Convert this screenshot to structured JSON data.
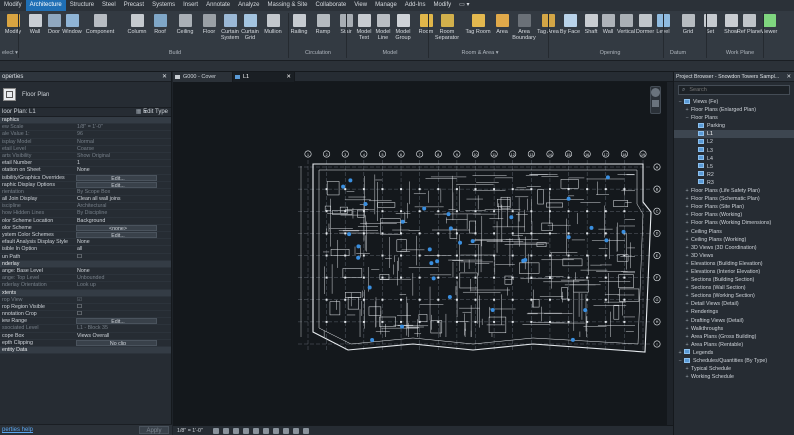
{
  "menu": [
    "Modify",
    "Architecture",
    "Structure",
    "Steel",
    "Precast",
    "Systems",
    "Insert",
    "Annotate",
    "Analyze",
    "Massing & Site",
    "Collaborate",
    "View",
    "Manage",
    "Add-Ins",
    "Modify",
    "▭ ▾"
  ],
  "menu_active_index": 1,
  "ribbon": {
    "buttons": [
      "Modify",
      "Wall",
      "Door",
      "Window",
      "Component",
      "Column",
      "Roof",
      "Ceiling",
      "Floor",
      "Curtain System",
      "Curtain Grid",
      "Mullion",
      "Railing",
      "Ramp",
      "Stair",
      "Model Text",
      "Model Line",
      "Model Group",
      "Room",
      "Room Separator",
      "Tag Room",
      "Area",
      "Area Boundary",
      "Tag Area",
      "By Face",
      "Shaft",
      "Wall",
      "Vertical",
      "Dormer",
      "Level",
      "Grid",
      "Set",
      "Show",
      "Ref Plane",
      "Viewer"
    ],
    "groups": [
      "elect ▾",
      "Build",
      "Circulation",
      "Model",
      "Room & Area ▾",
      "Opening",
      "Datum",
      "Work Plane"
    ]
  },
  "properties": {
    "title": "operties",
    "type_name": "Floor Plan",
    "instance_label": "loor Plan: L1",
    "edit_type_label": "Edit Type",
    "apply_label": "Apply",
    "help_link": "perties help",
    "rows": [
      {
        "k": "raphics",
        "v": "",
        "kind": "sec"
      },
      {
        "k": "ew Scale",
        "v": "1/8\" = 1'-0\"",
        "kind": "dim"
      },
      {
        "k": "ale Value 1:",
        "v": "96",
        "kind": "dim"
      },
      {
        "k": "isplay Model",
        "v": "Normal",
        "kind": "dim"
      },
      {
        "k": "etail Level",
        "v": "Coarse",
        "kind": "dim"
      },
      {
        "k": "arts Visibility",
        "v": "Show Original",
        "kind": "dim"
      },
      {
        "k": "etail Number",
        "v": "1",
        "kind": ""
      },
      {
        "k": "otation on Sheet",
        "v": "None",
        "kind": ""
      },
      {
        "k": "isibility/Graphics Overrides",
        "v": "Edit...",
        "kind": "btn"
      },
      {
        "k": "raphic Display Options",
        "v": "Edit...",
        "kind": "btn"
      },
      {
        "k": "rientation",
        "v": "By Scope Box",
        "kind": "dim"
      },
      {
        "k": "all Join Display",
        "v": "Clean all wall joins",
        "kind": ""
      },
      {
        "k": "iscipline",
        "v": "Architectural",
        "kind": "dim"
      },
      {
        "k": "how Hidden Lines",
        "v": "By Discipline",
        "kind": "dim"
      },
      {
        "k": "olor Scheme Location",
        "v": "Background",
        "kind": ""
      },
      {
        "k": "olor Scheme",
        "v": "<none>",
        "kind": "btn"
      },
      {
        "k": "ystem Color Schemes",
        "v": "Edit...",
        "kind": "btn"
      },
      {
        "k": "efault Analysis Display Style",
        "v": "None",
        "kind": ""
      },
      {
        "k": "isible In Option",
        "v": "all",
        "kind": ""
      },
      {
        "k": "un Path",
        "v": "☐",
        "kind": ""
      },
      {
        "k": "nderlay",
        "v": "",
        "kind": "sec"
      },
      {
        "k": "ange: Base Level",
        "v": "None",
        "kind": ""
      },
      {
        "k": "ange: Top Level",
        "v": "Unbounded",
        "kind": "dim"
      },
      {
        "k": "nderlay Orientation",
        "v": "Look up",
        "kind": "dim"
      },
      {
        "k": "xtents",
        "v": "",
        "kind": "sec"
      },
      {
        "k": "rop View",
        "v": "☑",
        "kind": "dim"
      },
      {
        "k": "rop Region Visible",
        "v": "☐",
        "kind": ""
      },
      {
        "k": "nnotation Crop",
        "v": "☐",
        "kind": ""
      },
      {
        "k": "iew Range",
        "v": "Edit...",
        "kind": "btn"
      },
      {
        "k": "ssociated Level",
        "v": "L1 - Block 35",
        "kind": "dim"
      },
      {
        "k": "cope Box",
        "v": "Views Overall",
        "kind": ""
      },
      {
        "k": "epth Clipping",
        "v": "No clip",
        "kind": "btn"
      },
      {
        "k": "entity Data",
        "v": "",
        "kind": "sec"
      }
    ]
  },
  "view_tabs": [
    {
      "label": "G000 - Cover"
    },
    {
      "label": "L1",
      "active": true
    }
  ],
  "status_scale": "1/8\" = 1'-0\"",
  "browser": {
    "title": "Project Browser - Snowdon Towers Sampl...",
    "search_placeholder": "Search",
    "items": [
      {
        "d": 0,
        "t": "−",
        "label": "Views (Fe)",
        "icon": true
      },
      {
        "d": 1,
        "t": "+",
        "label": "Floor Plans (Enlarged Plan)"
      },
      {
        "d": 1,
        "t": "−",
        "label": "Floor Plans"
      },
      {
        "d": 2,
        "t": "",
        "label": "Parking",
        "icon": true
      },
      {
        "d": 2,
        "t": "",
        "label": "L1",
        "icon": true,
        "sel": true
      },
      {
        "d": 2,
        "t": "",
        "label": "L2",
        "icon": true
      },
      {
        "d": 2,
        "t": "",
        "label": "L3",
        "icon": true
      },
      {
        "d": 2,
        "t": "",
        "label": "L4",
        "icon": true
      },
      {
        "d": 2,
        "t": "",
        "label": "L5",
        "icon": true
      },
      {
        "d": 2,
        "t": "",
        "label": "R2",
        "icon": true
      },
      {
        "d": 2,
        "t": "",
        "label": "R3",
        "icon": true
      },
      {
        "d": 1,
        "t": "+",
        "label": "Floor Plans (Life Safety Plan)"
      },
      {
        "d": 1,
        "t": "+",
        "label": "Floor Plans (Schematic Plan)"
      },
      {
        "d": 1,
        "t": "+",
        "label": "Floor Plans (Site Plan)"
      },
      {
        "d": 1,
        "t": "+",
        "label": "Floor Plans (Working)"
      },
      {
        "d": 1,
        "t": "+",
        "label": "Floor Plans (Working Dimensions)"
      },
      {
        "d": 1,
        "t": "+",
        "label": "Ceiling Plans"
      },
      {
        "d": 1,
        "t": "+",
        "label": "Ceiling Plans (Working)"
      },
      {
        "d": 1,
        "t": "+",
        "label": "3D Views (3D Coordination)"
      },
      {
        "d": 1,
        "t": "+",
        "label": "3D Views"
      },
      {
        "d": 1,
        "t": "+",
        "label": "Elevations (Building Elevation)"
      },
      {
        "d": 1,
        "t": "+",
        "label": "Elevations (Interior Elevation)"
      },
      {
        "d": 1,
        "t": "+",
        "label": "Sections (Building Section)"
      },
      {
        "d": 1,
        "t": "+",
        "label": "Sections (Wall Section)"
      },
      {
        "d": 1,
        "t": "+",
        "label": "Sections (Working Section)"
      },
      {
        "d": 1,
        "t": "+",
        "label": "Detail Views (Detail)"
      },
      {
        "d": 1,
        "t": "+",
        "label": "Renderings"
      },
      {
        "d": 1,
        "t": "+",
        "label": "Drafting Views (Detail)"
      },
      {
        "d": 1,
        "t": "+",
        "label": "Walkthroughs"
      },
      {
        "d": 1,
        "t": "+",
        "label": "Area Plans (Gross Building)"
      },
      {
        "d": 1,
        "t": "+",
        "label": "Area Plans (Rentable)"
      },
      {
        "d": 0,
        "t": "+",
        "label": "Legends",
        "icon": true
      },
      {
        "d": 0,
        "t": "−",
        "label": "Schedules/Quantities (By Type)",
        "icon": true
      },
      {
        "d": 1,
        "t": "+",
        "label": "Typical Schedule"
      },
      {
        "d": 1,
        "t": "+",
        "label": "Working Schedule"
      }
    ]
  },
  "grid_labels_top": [
    "1",
    "2",
    "3",
    "4",
    "5",
    "6",
    "7",
    "8",
    "9",
    "10",
    "11",
    "12",
    "13",
    "14",
    "15",
    "16",
    "17",
    "18",
    "19"
  ],
  "grid_labels_right": [
    "A",
    "B",
    "C",
    "D",
    "E",
    "F",
    "G",
    "H",
    "I"
  ],
  "colors": {
    "accent": "#1f6fb5",
    "background": "#14181c",
    "linework": "#e8ecef",
    "tags": "#3a8fe0"
  }
}
